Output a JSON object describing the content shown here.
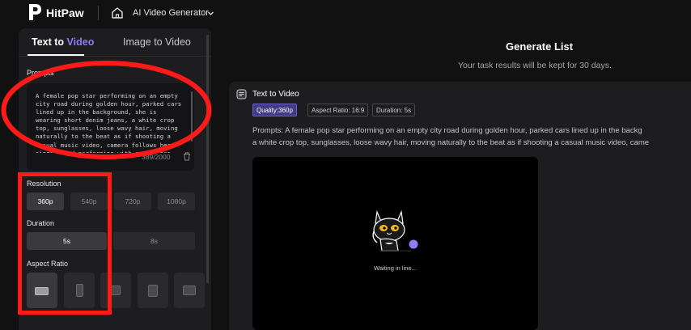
{
  "app": {
    "brand": "HitPaw",
    "product": "AI Video Generator"
  },
  "tabs": [
    {
      "label_a": "Text to ",
      "label_b": "Video",
      "active": true
    },
    {
      "label": "Image to Video",
      "active": false
    }
  ],
  "prompt": {
    "label": "Prompts",
    "text": "A female pop star performing on an empty city road during golden hour, parked cars lined up in the background, she is wearing short denim jeans, a white crop top, sunglasses, loose wavy hair, moving naturally to the beat as if shooting a casual music video, camera follows her singing and performing with confidence",
    "count": "389/2000"
  },
  "resolution": {
    "label": "Resolution",
    "options": [
      "360p",
      "540p",
      "720p",
      "1080p"
    ],
    "selected": "360p"
  },
  "duration": {
    "label": "Duration",
    "options": [
      "5s",
      "8s"
    ],
    "selected": "5s"
  },
  "aspect_ratio": {
    "label": "Aspect Ratio",
    "options": [
      "16:9",
      "9:16",
      "1:1",
      "3:4",
      "4:3"
    ],
    "selected": "16:9"
  },
  "generate": {
    "title": "Generate List",
    "subtitle": "Your task results will be kept for 30 days."
  },
  "task": {
    "title": "Text to Video",
    "tags": [
      "Quality:360p",
      "Aspect Ratio: 16:9",
      "Duration: 5s"
    ],
    "prompt_line1": "Prompts:  A female pop star performing on an empty city road during golden hour, parked cars lined up in the backg",
    "prompt_line2": "a white crop top, sunglasses, loose wavy hair, moving naturally to the beat as if shooting a casual music video, came",
    "status": "Waiting in line..."
  },
  "colors": {
    "accent": "#8f7bff",
    "annotation": "#ff1a1a",
    "background": "#111111",
    "panel": "#1d1d1f"
  }
}
